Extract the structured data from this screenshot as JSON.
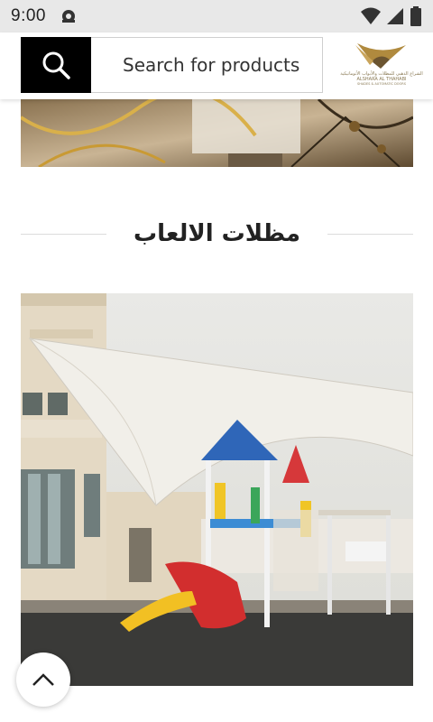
{
  "status_bar": {
    "time": "9:00",
    "icons": [
      "notification-icon",
      "wifi-icon",
      "signal-icon",
      "battery-icon"
    ]
  },
  "header": {
    "search_icon": "search-icon",
    "search_placeholder": "Search for products",
    "logo": {
      "name": "ALSHARA AL THAHABI",
      "subtitle": "SHADES & AUTOMATIC DOORS",
      "arabic": "الشراع الذهبي للمظلات والأبواب الأتوماتيكية"
    }
  },
  "section": {
    "title": "مظلات الالعاب"
  },
  "scroll_top_icon": "chevron-up-icon",
  "colors": {
    "header_button": "#000000",
    "brand_gold": "#b08a3e",
    "status_bar": "#e8e8e8"
  }
}
